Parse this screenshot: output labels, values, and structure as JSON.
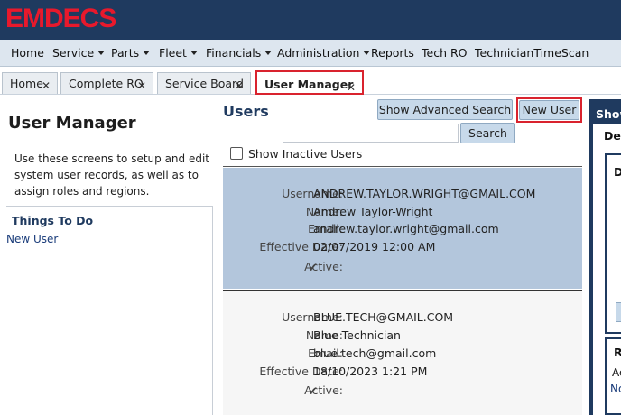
{
  "app": {
    "logo_text": "EMDECS"
  },
  "menu": {
    "items": [
      {
        "label": "Home",
        "has_dropdown": false
      },
      {
        "label": "Service",
        "has_dropdown": true
      },
      {
        "label": "Parts",
        "has_dropdown": true
      },
      {
        "label": "Fleet",
        "has_dropdown": true
      },
      {
        "label": "Financials",
        "has_dropdown": true
      },
      {
        "label": "Administration",
        "has_dropdown": true
      },
      {
        "label": "Reports",
        "has_dropdown": false
      },
      {
        "label": "Tech RO",
        "has_dropdown": false
      },
      {
        "label": "TechnicianTimeScan",
        "has_dropdown": false
      }
    ]
  },
  "tabs": {
    "items": [
      {
        "label": "Home",
        "close": "✕"
      },
      {
        "label": "Complete RO",
        "close": "✕"
      },
      {
        "label": "Service Board",
        "close": "✕"
      },
      {
        "label": "User Manager",
        "close": "✕",
        "active": true
      }
    ]
  },
  "left_panel": {
    "title": "User Manager",
    "description": "Use these screens to setup and edit system user records, as well as to assign roles and regions.",
    "todo_title": "Things To Do",
    "todo_link": "New User"
  },
  "users": {
    "title": "Users",
    "advanced_search_label": "Show Advanced Search",
    "new_user_label": "New User",
    "search_value": "",
    "search_button_label": "Search",
    "show_inactive_label": "Show Inactive Users",
    "show_inactive_checked": false,
    "field_labels": {
      "username": "Username:",
      "name": "Name:",
      "email": "Email:",
      "effective_date": "Effective Date:",
      "active": "Active:"
    },
    "records": [
      {
        "username": "ANDREW.TAYLOR.WRIGHT@GMAIL.COM",
        "name": "Andrew Taylor-Wright",
        "email": "andrew.taylor.wright@gmail.com",
        "effective_date": "02/07/2019 12:00 AM",
        "active": "✔",
        "selected": true
      },
      {
        "username": "BLUE.TECH@GMAIL.COM",
        "name": "Blue Technician",
        "email": "blue.tech@gmail.com",
        "effective_date": "18/10/2023 1:21 PM",
        "active": "✔",
        "selected": false
      }
    ]
  },
  "right_panel": {
    "title": "Show",
    "tab_label": "Det",
    "box1_letter": "D",
    "box2_letter": "R",
    "box2_text1": "Ac",
    "box2_text2": "No"
  },
  "colors": {
    "header_bg": "#1f3a5f",
    "logo_red": "#e8192c",
    "highlight_red": "#d9232e",
    "selected_row": "#b3c6dc",
    "button_bg": "#c7d9ea"
  }
}
